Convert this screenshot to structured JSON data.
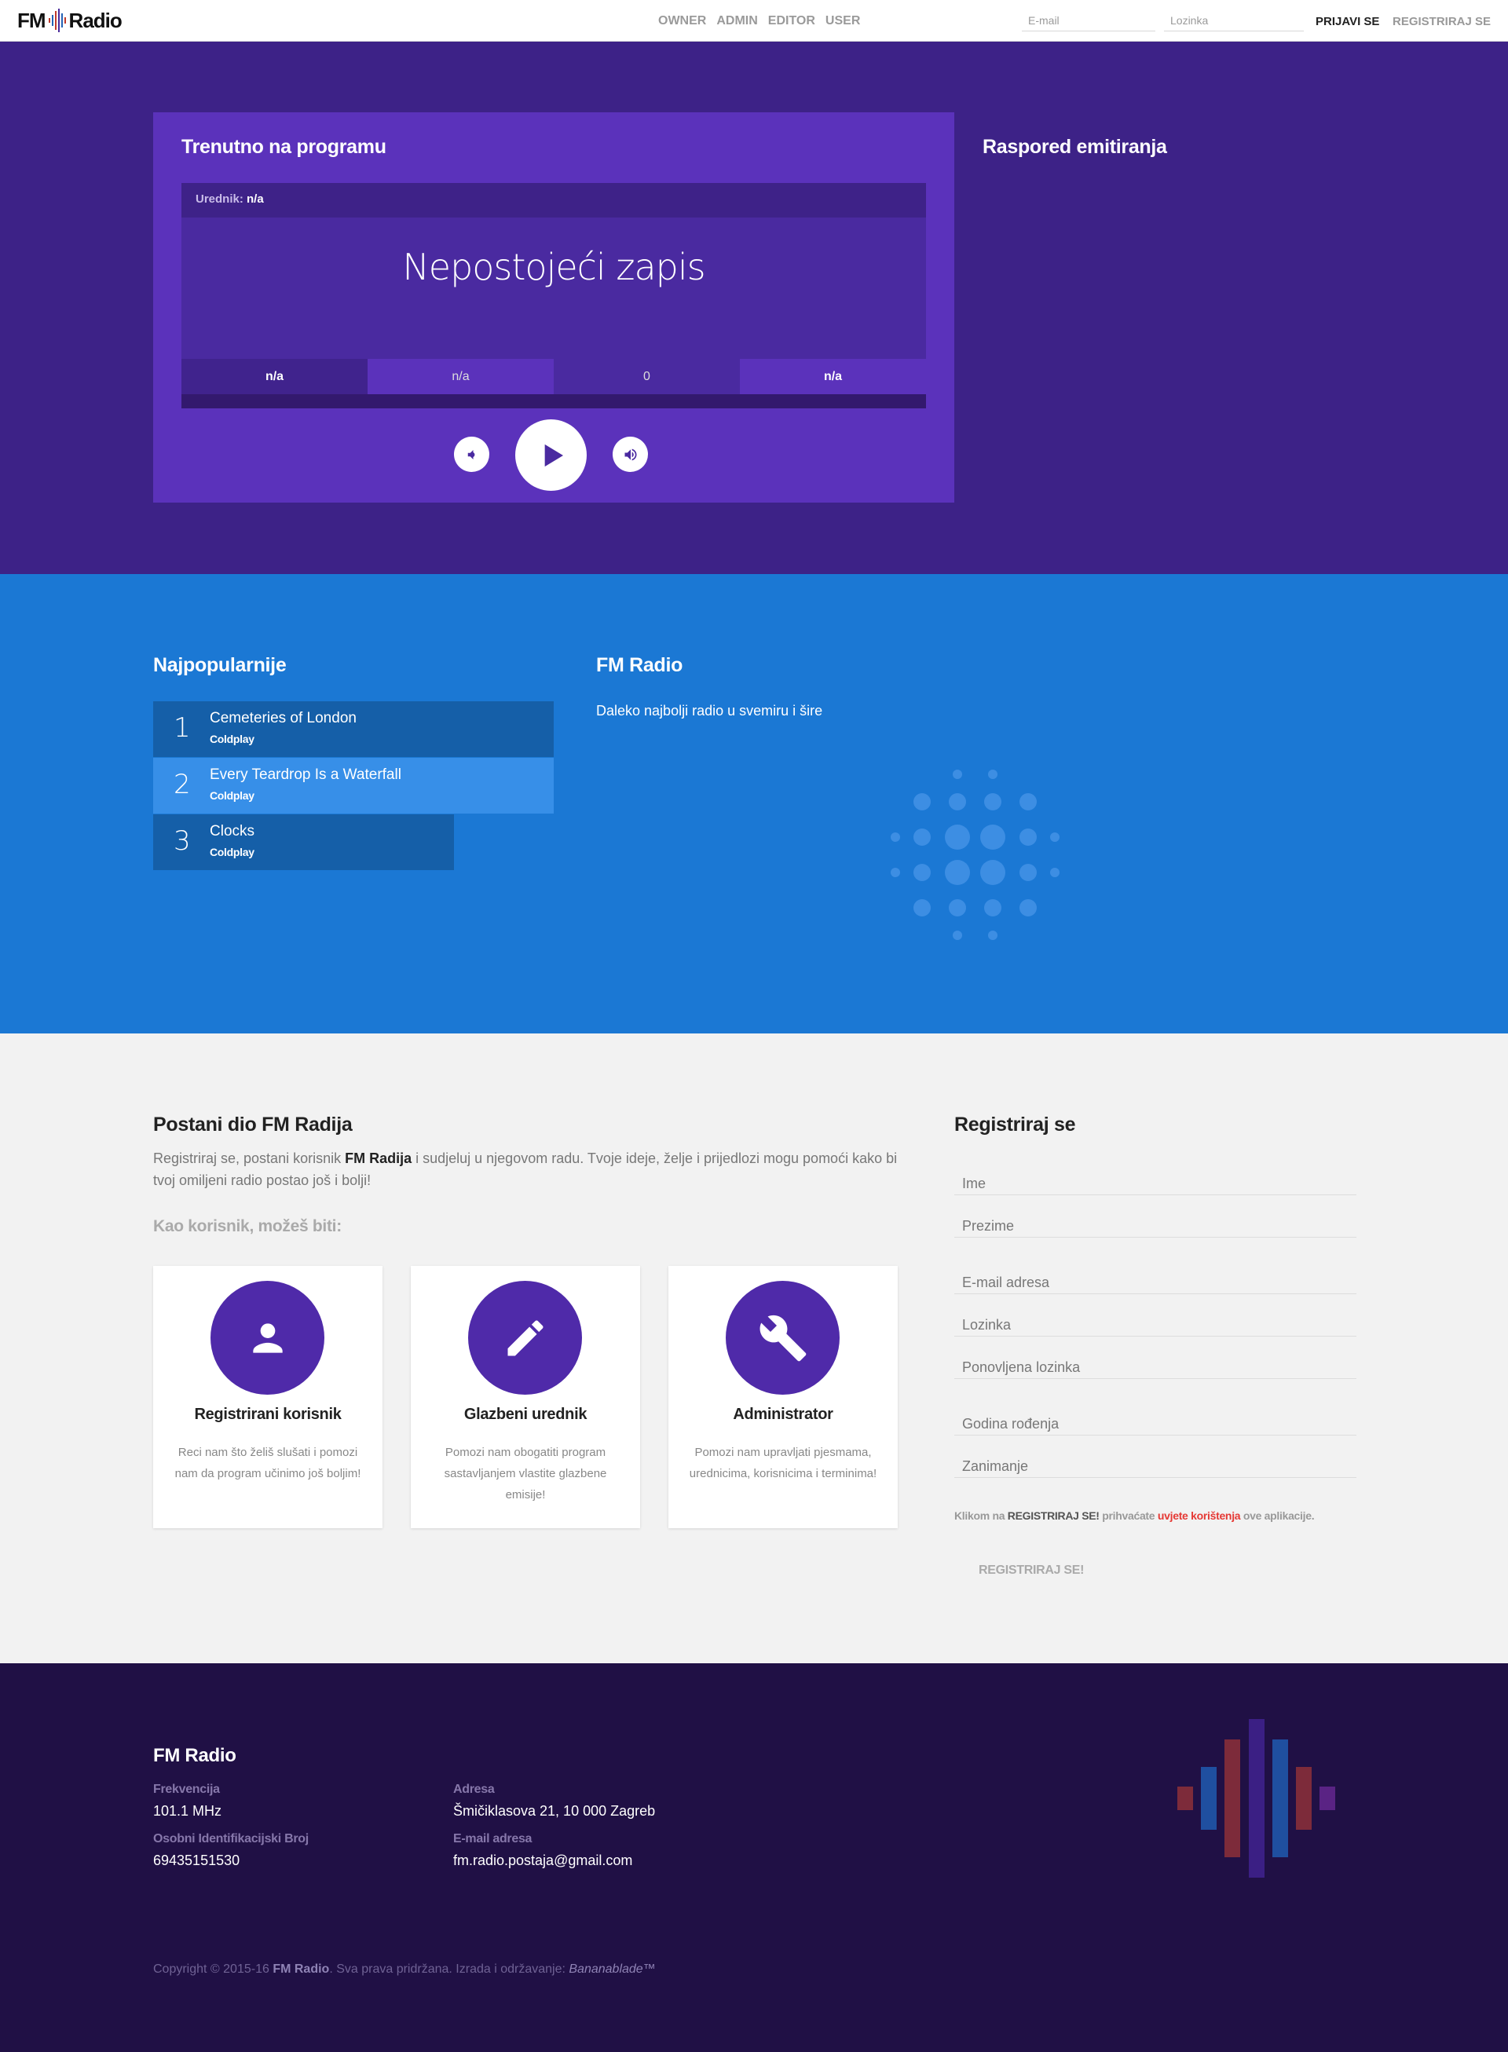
{
  "navbar": {
    "logo_left": "FM",
    "logo_right": "Radio",
    "links": [
      "OWNER",
      "ADMIN",
      "EDITOR",
      "USER"
    ],
    "email_placeholder": "E-mail",
    "password_placeholder": "Lozinka",
    "login_label": "PRIJAVI SE",
    "register_label": "REGISTRIRAJ SE"
  },
  "now_playing": {
    "title": "Trenutno na programu",
    "editor_label": "Urednik:",
    "editor_value": "n/a",
    "track": "Nepostojeći zapis",
    "stats": [
      "n/a",
      "n/a",
      "0",
      "n/a"
    ]
  },
  "schedule": {
    "title": "Raspored emitiranja"
  },
  "popular": {
    "title": "Najpopularnije",
    "items": [
      {
        "rank": "1",
        "song": "Cemeteries of London",
        "artist": "Coldplay",
        "color": "#155fa8"
      },
      {
        "rank": "2",
        "song": "Every Teardrop Is a Waterfall",
        "artist": "Coldplay",
        "color": "#378fe8"
      },
      {
        "rank": "3",
        "song": "Clocks",
        "artist": "Coldplay",
        "color": "#155fa8"
      }
    ]
  },
  "about": {
    "title": "FM Radio",
    "tagline": "Daleko najbolji radio u svemiru i šire"
  },
  "join": {
    "title": "Postani dio FM Radija",
    "text_before": "Registriraj se, postani korisnik ",
    "text_bold": "FM Radija",
    "text_after": " i sudjeluj u njegovom radu. Tvoje ideje, želje i prijedlozi mogu pomoći kako bi tvoj omiljeni radio postao još i bolji!",
    "subtitle": "Kao korisnik, možeš biti:",
    "roles": [
      {
        "name": "Registrirani korisnik",
        "desc": "Reci nam što želiš slušati i pomozi nam da program učinimo još boljim!",
        "icon": "person-icon"
      },
      {
        "name": "Glazbeni urednik",
        "desc": "Pomozi nam obogatiti program sastavljanjem vlastite glazbene emisije!",
        "icon": "pencil-icon"
      },
      {
        "name": "Administrator",
        "desc": "Pomozi nam upravljati pjesmama, urednicima, korisnicima i terminima!",
        "icon": "wrench-icon"
      }
    ]
  },
  "register": {
    "title": "Registriraj se",
    "fields": [
      "Ime",
      "Prezime",
      "E-mail adresa",
      "Lozinka",
      "Ponovljena lozinka",
      "Godina rođenja",
      "Zanimanje"
    ],
    "terms_1": "Klikom na ",
    "terms_2": "REGISTRIRAJ SE!",
    "terms_3": " prihvaćate ",
    "terms_4": "uvjete korištenja",
    "terms_5": " ove aplikacije.",
    "submit": "REGISTRIRAJ SE!"
  },
  "footer": {
    "title": "FM Radio",
    "freq_label": "Frekvencija",
    "freq_value": "101.1 MHz",
    "oib_label": "Osobni Identifikacijski Broj",
    "oib_value": "69435151530",
    "address_label": "Adresa",
    "address_value": "Šmičiklasova 21, 10 000 Zagreb",
    "email_label": "E-mail adresa",
    "email_value": "fm.radio.postaja@gmail.com",
    "copy_1": "Copyright © 2015-16 ",
    "copy_2": "FM Radio",
    "copy_3": ". Sva prava pridržana. Izrada i održavanje: ",
    "copy_4": "Bananablade™"
  },
  "colors": {
    "hero_bg": "#3d2287",
    "player_bg": "#5b32bb",
    "popular_bg": "#1b78d4",
    "footer_bg": "#201045",
    "role_circle": "#4f2aa9",
    "terms_link": "#e53935"
  }
}
